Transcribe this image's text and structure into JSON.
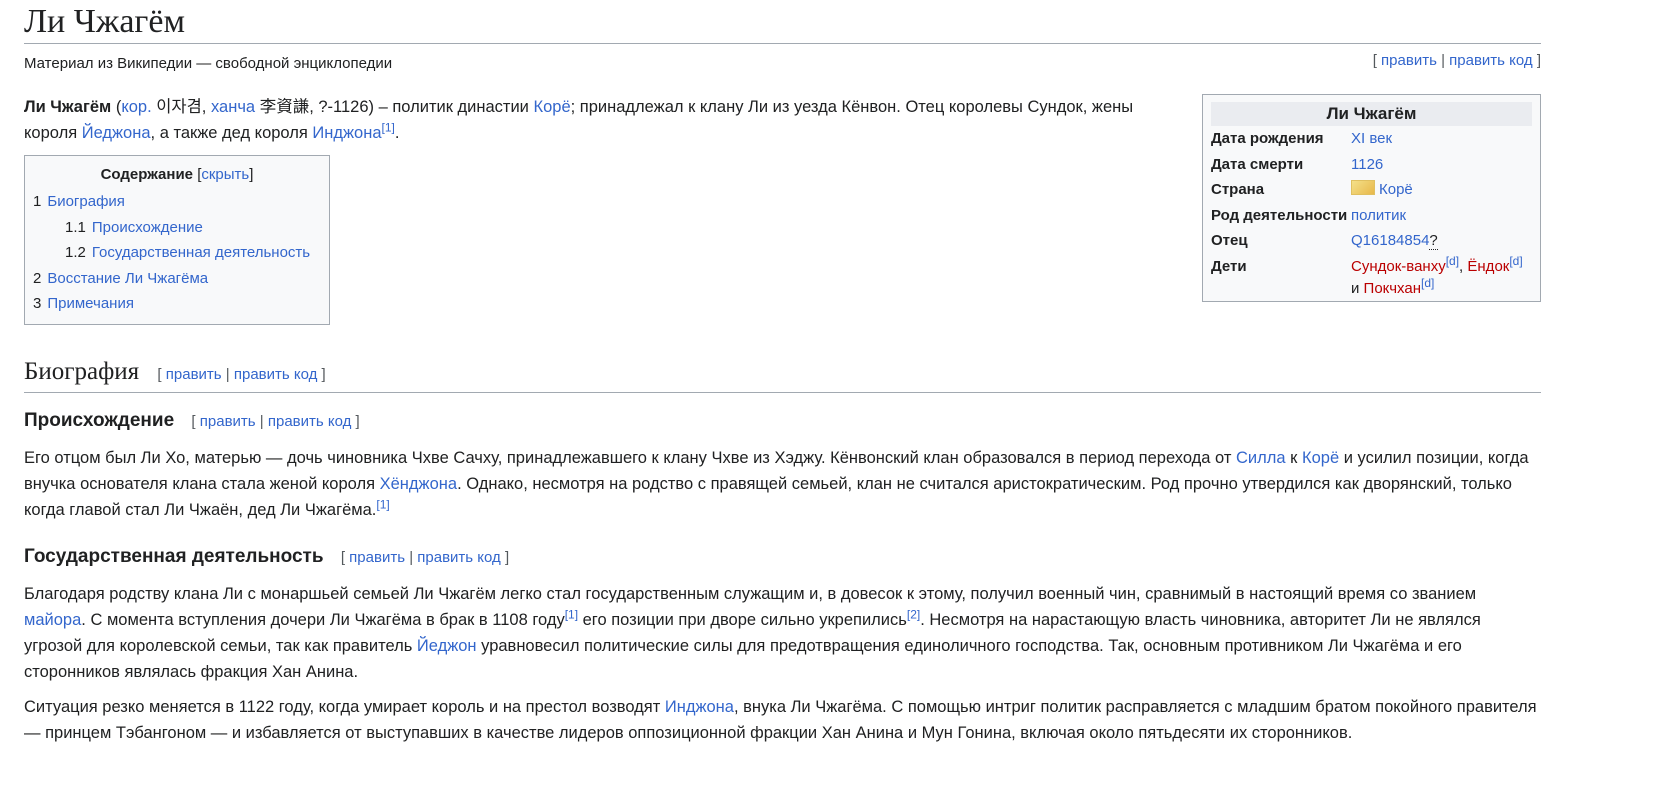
{
  "title": "Ли Чжагём",
  "tagline": "Материал из Википедии — свободной энциклопедии",
  "edit": {
    "open": "[",
    "sep": "|",
    "close": "]",
    "edit": "править",
    "edit_code": "править код"
  },
  "lead": {
    "bold": "Ли Чжагём",
    "t1": " (",
    "kor": "кор.",
    "hangul": " 이자겸, ",
    "hancha": "ханча",
    "t2": " 李資謙, ?-1126) – политик династии ",
    "korye": "Корё",
    "t3": "; принадлежал к клану Ли из уезда Кёнвон. Отец королевы Сундок, жены короля ",
    "yejong": "Йеджона",
    "t4": ", а также дед короля ",
    "injong": "Инджона",
    "ref": "[1]",
    "t5": "."
  },
  "toc": {
    "title": "Содержание",
    "hide": "скрыть",
    "lb": "[",
    "rb": "]",
    "items": [
      {
        "num": "1",
        "label": "Биография"
      },
      {
        "num": "1.1",
        "label": "Происхождение"
      },
      {
        "num": "1.2",
        "label": "Государственная деятельность"
      },
      {
        "num": "2",
        "label": "Восстание Ли Чжагёма"
      },
      {
        "num": "3",
        "label": "Примечания"
      }
    ]
  },
  "infobox": {
    "caption": "Ли Чжагём",
    "birth_k": "Дата рождения",
    "birth_v": "XI век",
    "death_k": "Дата смерти",
    "death_v": "1126",
    "country_k": "Страна",
    "country_v": "Корё",
    "occ_k": "Род деятельности",
    "occ_v": "политик",
    "father_k": "Отец",
    "father_v": "Q16184854",
    "father_q": "?",
    "children_k": "Дети",
    "child1": "Сундок-ванху",
    "child2": "Ёндок",
    "child3": "Покчхан",
    "d": "[d]",
    "comma": ", ",
    "and": " и "
  },
  "biography": {
    "heading": "Биография"
  },
  "origin": {
    "heading": "Происхождение",
    "t1": "Его отцом был Ли Хо, матерью — дочь чиновника Чхве Сачху, принадлежавшего к клану Чхве из Хэджу. Кёнвонский клан образовался в период перехода от ",
    "silla": "Силла",
    "t2": " к ",
    "korye": "Корё",
    "t3": " и усилил позиции, когда внучка основателя клана стала женой короля ",
    "hyonjong": "Хёнджона",
    "t4": ". Однако, несмотря на родство с правящей семьей, клан не считался аристократическим. Род прочно утвердился как дворянский, только когда главой стал Ли Чжаён, дед Ли Чжагёма.",
    "ref": "[1]"
  },
  "state": {
    "heading": "Государственная деятельность",
    "p1_t1": "Благодаря родству клана Ли с монаршьей семьей Ли Чжагём легко стал государственным служащим и, в довесок к этому, получил военный чин, сравнимый в настоящий время со званием ",
    "major": "майора",
    "p1_t2": ". С момента вступления дочери Ли Чжагёма в брак в 1108 году",
    "ref1": "[1]",
    "p1_t3": " его позиции при дворе сильно укрепились",
    "ref2": "[2]",
    "p1_t4": ". Несмотря на нарастающую власть чиновника, авторитет Ли не являлся угрозой для королевской семьи, так как правитель ",
    "yejong": "Йеджон",
    "p1_t5": " уравновесил политические силы для предотвращения единоличного господства. Так, основным противником Ли Чжагёма и его сторонников являлась фракция Хан Анина.",
    "p2_t1": "Ситуация резко меняется в 1122 году, когда умирает король и на престол возводят ",
    "injong": "Инджона",
    "p2_t2": ", внука Ли Чжагёма. С помощью интриг политик расправляется с младшим братом покойного правителя — принцем Тэбангоном — и избавляется от выступавших в качестве лидеров оппозиционной фракции Хан Анина и Мун Гонина, включая около пятьдесяти их сторонников."
  }
}
